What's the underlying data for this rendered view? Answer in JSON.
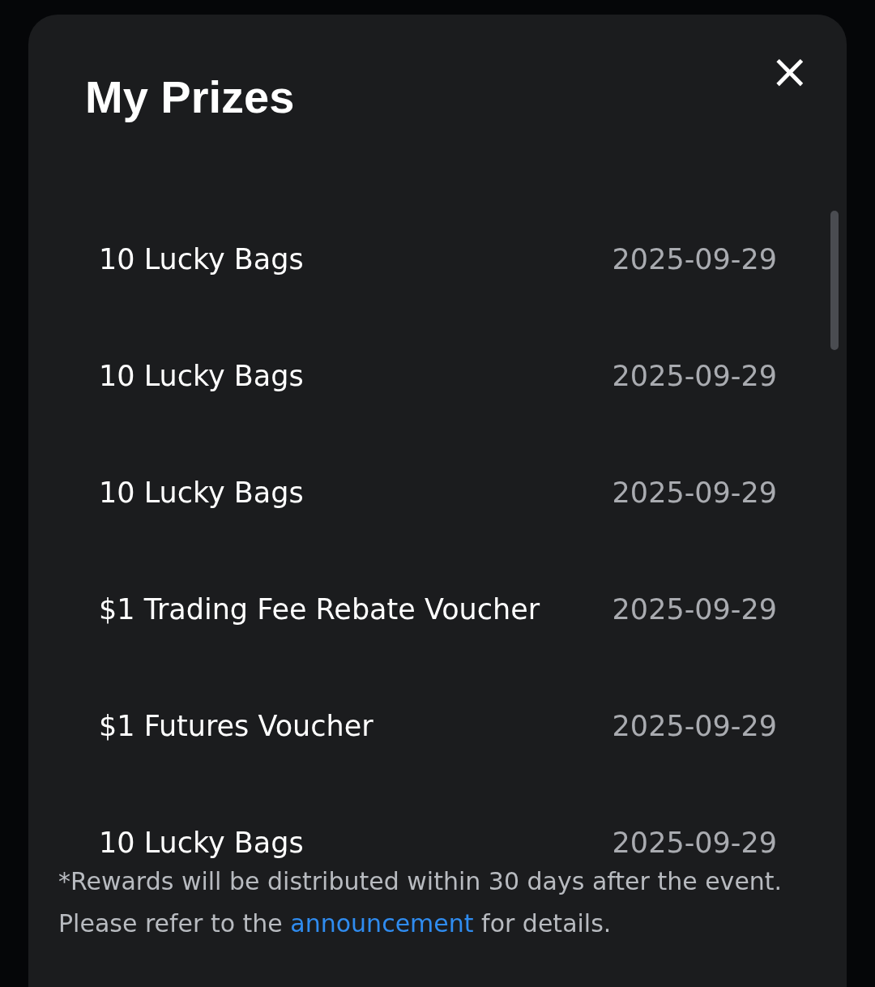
{
  "dialog": {
    "title": "My Prizes",
    "close": "×"
  },
  "prizes": [
    {
      "name": "10 Lucky Bags",
      "date": "2025-09-29"
    },
    {
      "name": "10 Lucky Bags",
      "date": "2025-09-29"
    },
    {
      "name": "10 Lucky Bags",
      "date": "2025-09-29"
    },
    {
      "name": "$1 Trading Fee Rebate Voucher",
      "date": "2025-09-29"
    },
    {
      "name": "$1 Futures Voucher",
      "date": "2025-09-29"
    },
    {
      "name": "10 Lucky Bags",
      "date": "2025-09-29"
    }
  ],
  "note": {
    "text_before": "*Rewards will be distributed within 30 days after the event. Please refer to the",
    "link": "announcement",
    "text_after": "for details."
  }
}
